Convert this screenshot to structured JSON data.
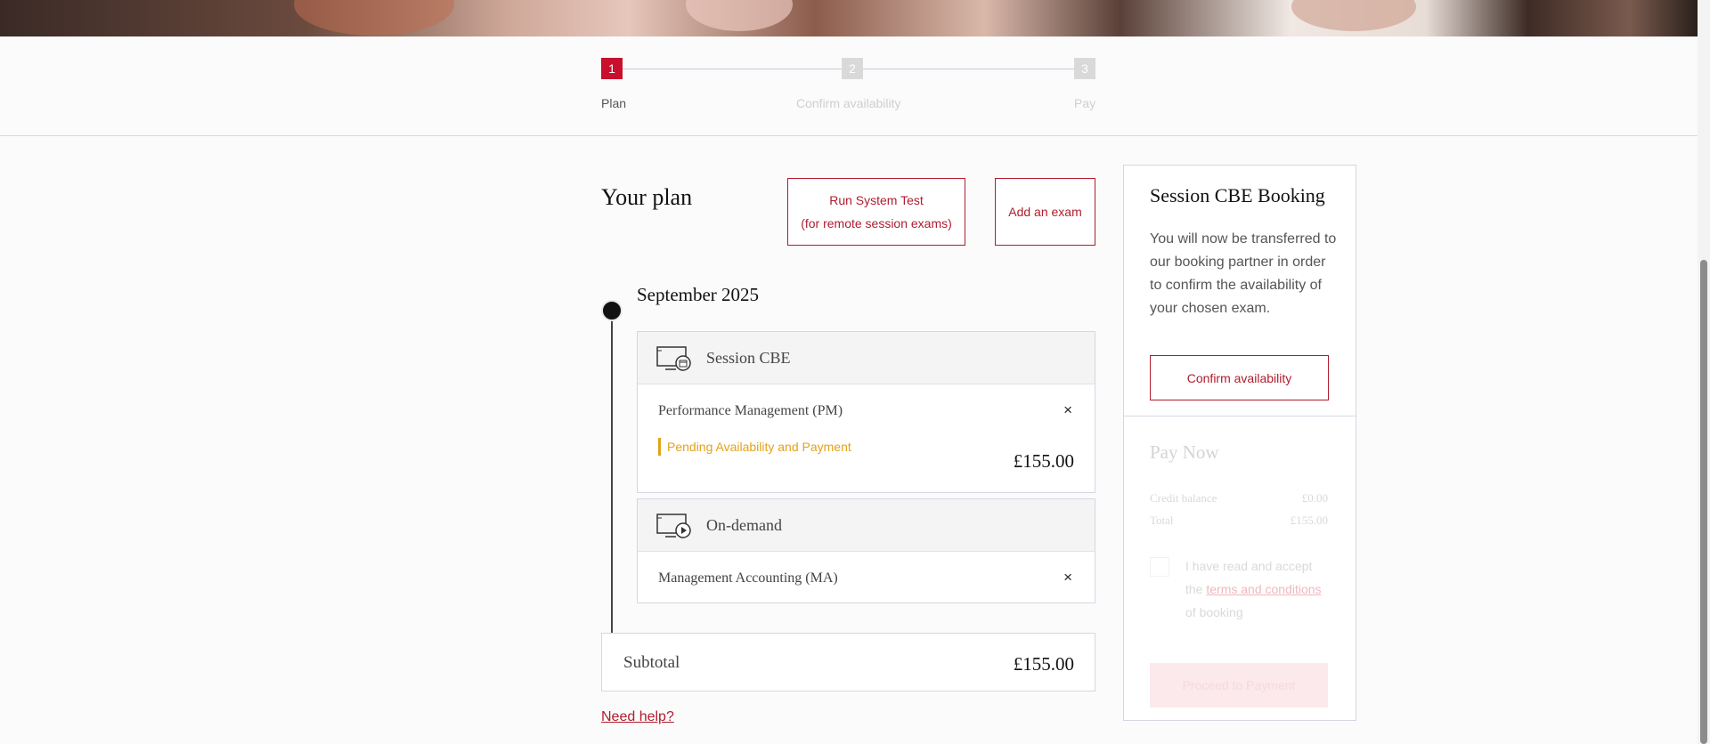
{
  "stepper": {
    "steps": [
      {
        "num": "1",
        "label": "Plan"
      },
      {
        "num": "2",
        "label": "Confirm availability"
      },
      {
        "num": "3",
        "label": "Pay"
      }
    ]
  },
  "plan": {
    "title": "Your plan",
    "run_test_line1": "Run System Test",
    "run_test_line2": "(for remote session exams)",
    "add_exam": "Add an exam",
    "month": "September 2025",
    "groups": [
      {
        "name": "Session CBE",
        "icon": "monitor-calendar-icon",
        "exam": "Performance Management (PM)",
        "status": "Pending Availability and Payment",
        "price": "£155.00"
      },
      {
        "name": "On-demand",
        "icon": "monitor-play-icon",
        "exam": "Management Accounting (MA)"
      }
    ],
    "subtotal_label": "Subtotal",
    "subtotal_value": "£155.00",
    "help": "Need help?"
  },
  "sidebar": {
    "title": "Session CBE Booking",
    "text": "You will now be transferred to our booking partner in order to confirm the availability of your chosen exam.",
    "confirm": "Confirm availability",
    "pay_title": "Pay Now",
    "credit_label": "Credit balance",
    "credit_value": "£0.00",
    "total_label": "Total",
    "total_value": "£155.00",
    "terms_pre": "I have read and accept the",
    "terms_link": "terms and conditions",
    "terms_post": "of booking",
    "proceed": "Proceed to Payment"
  },
  "colors": {
    "accent": "#b01c2e",
    "active_step": "#c8102e",
    "pending": "#e3a21a"
  }
}
